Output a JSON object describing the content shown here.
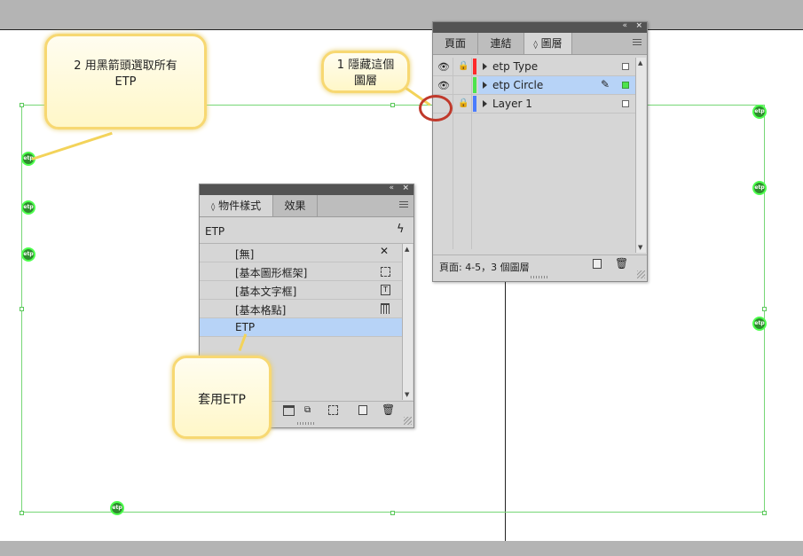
{
  "callouts": {
    "select_all": "2 用黑箭頭選取所有\nETP",
    "hide_layer": "1 隱藏這個\n圖層",
    "apply": "套用ETP"
  },
  "canvas": {
    "marker_label": "etp"
  },
  "layers_panel": {
    "tabs": [
      {
        "label": "頁面"
      },
      {
        "label": "連結"
      },
      {
        "label": "圖層",
        "prefix": "◊"
      }
    ],
    "layers": [
      {
        "name": "etp Type",
        "color": "#ff2a2a",
        "visible": true,
        "locked": true,
        "selected": false
      },
      {
        "name": "etp Circle",
        "color": "#4ce44c",
        "visible": true,
        "locked": false,
        "selected": true
      },
      {
        "name": "Layer 1",
        "color": "#4a7cff",
        "visible": false,
        "locked": true,
        "selected": false
      }
    ],
    "status": "頁面: 4-5，3 個圖層"
  },
  "styles_panel": {
    "tabs": [
      {
        "label": "物件樣式",
        "prefix": "◊"
      },
      {
        "label": "效果"
      }
    ],
    "current_style": "ETP",
    "styles": [
      {
        "label": "[無]",
        "icon": "no-style-icon"
      },
      {
        "label": "[基本圖形框架]",
        "icon": "graphic-frame-icon"
      },
      {
        "label": "[基本文字框]",
        "icon": "text-frame-icon"
      },
      {
        "label": "[基本格點]",
        "icon": "grid-icon"
      },
      {
        "label": "ETP",
        "icon": "",
        "selected": true
      }
    ]
  },
  "colors": {
    "selection": "#b7d3f7",
    "callout_border": "#f7d872",
    "highlight_circle": "#c0392b"
  }
}
